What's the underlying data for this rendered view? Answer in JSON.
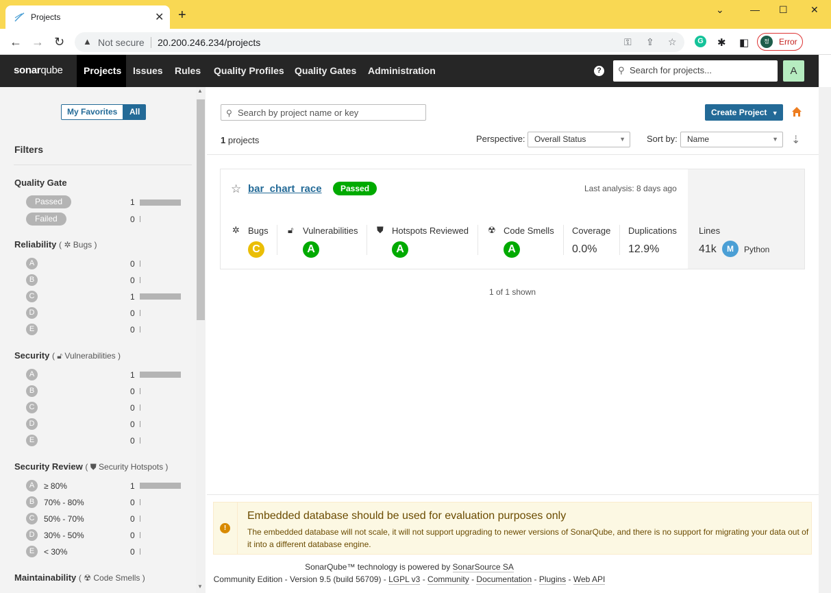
{
  "browser": {
    "tab_title": "Projects",
    "not_secure": "Not secure",
    "url": "20.200.246.234/projects",
    "profile_initial": "정",
    "profile_status": "Error",
    "grammarly": "G"
  },
  "nav": {
    "logo_sonar": "sonar",
    "logo_qube": "qube",
    "items": [
      "Projects",
      "Issues",
      "Rules",
      "Quality Profiles",
      "Quality Gates",
      "Administration"
    ],
    "help": "?",
    "search_placeholder": "Search for projects...",
    "user_initial": "A"
  },
  "sidebar": {
    "my_favorites": "My Favorites",
    "all": "All",
    "filters_title": "Filters",
    "quality_gate": {
      "title": "Quality Gate",
      "options": [
        {
          "label": "Passed",
          "count": "1",
          "frac": 1
        },
        {
          "label": "Failed",
          "count": "0",
          "frac": 0
        }
      ]
    },
    "reliability": {
      "title": "Reliability",
      "sub": "Bugs",
      "ratings": [
        {
          "r": "A",
          "count": "0",
          "frac": 0
        },
        {
          "r": "B",
          "count": "0",
          "frac": 0
        },
        {
          "r": "C",
          "count": "1",
          "frac": 1
        },
        {
          "r": "D",
          "count": "0",
          "frac": 0
        },
        {
          "r": "E",
          "count": "0",
          "frac": 0
        }
      ]
    },
    "security": {
      "title": "Security",
      "sub": "Vulnerabilities",
      "ratings": [
        {
          "r": "A",
          "count": "1",
          "frac": 1
        },
        {
          "r": "B",
          "count": "0",
          "frac": 0
        },
        {
          "r": "C",
          "count": "0",
          "frac": 0
        },
        {
          "r": "D",
          "count": "0",
          "frac": 0
        },
        {
          "r": "E",
          "count": "0",
          "frac": 0
        }
      ]
    },
    "security_review": {
      "title": "Security Review",
      "sub": "Security Hotspots",
      "ratings": [
        {
          "r": "A",
          "label": "≥ 80%",
          "count": "1",
          "frac": 1
        },
        {
          "r": "B",
          "label": "70% - 80%",
          "count": "0",
          "frac": 0
        },
        {
          "r": "C",
          "label": "50% - 70%",
          "count": "0",
          "frac": 0
        },
        {
          "r": "D",
          "label": "30% - 50%",
          "count": "0",
          "frac": 0
        },
        {
          "r": "E",
          "label": "< 30%",
          "count": "0",
          "frac": 0
        }
      ]
    },
    "maintainability": {
      "title": "Maintainability",
      "sub": "Code Smells"
    }
  },
  "main": {
    "search_placeholder": "Search by project name or key",
    "create_project": "Create Project",
    "project_count": "1",
    "project_count_label": "projects",
    "perspective_label": "Perspective:",
    "perspective_value": "Overall Status",
    "sort_label": "Sort by:",
    "sort_value": "Name",
    "shown": "1 of 1 shown"
  },
  "project": {
    "name": "bar_chart_race",
    "gate": "Passed",
    "last_analysis": "Last analysis: 8 days ago",
    "bugs_label": "Bugs",
    "bugs_rating": "C",
    "vuln_label": "Vulnerabilities",
    "vuln_rating": "A",
    "hotspots_label": "Hotspots Reviewed",
    "hotspots_rating": "A",
    "smells_label": "Code Smells",
    "smells_rating": "A",
    "coverage_label": "Coverage",
    "coverage_value": "0.0%",
    "dup_label": "Duplications",
    "dup_value": "12.9%",
    "lines_label": "Lines",
    "lines_value": "41k",
    "lang_icon": "M",
    "lang": "Python"
  },
  "colors": {
    "rating_a": "#00aa00",
    "rating_c": "#eabe06",
    "accent": "#236a97"
  },
  "warning": {
    "title": "Embedded database should be used for evaluation purposes only",
    "body": "The embedded database will not scale, it will not support upgrading to newer versions of SonarQube, and there is no support for migrating your data out of it into a different database engine."
  },
  "footer": {
    "powered": "SonarQube™ technology is powered by",
    "sonarsource": "SonarSource SA",
    "edition": "Community Edition - Version 9.5 (build 56709) -",
    "lgpl": "LGPL v3",
    "community": "Community",
    "documentation": "Documentation",
    "plugins": "Plugins",
    "webapi": "Web API",
    "dash": "-"
  }
}
